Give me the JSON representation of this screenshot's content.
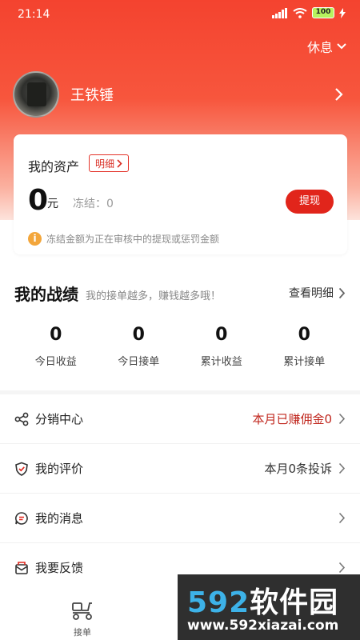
{
  "status_bar": {
    "time": "21:14",
    "battery": "100"
  },
  "header": {
    "rest_label": "休息",
    "user_name": "王铁锤"
  },
  "assets": {
    "title": "我的资产",
    "detail_label": "明细",
    "amount": "0",
    "unit": "元",
    "frozen_label": "冻结：0",
    "withdraw_label": "提现",
    "notice": "冻结金额为正在审核中的提现或惩罚金额"
  },
  "performance": {
    "title": "我的战绩",
    "subtitle": "我的接单越多，赚钱越多哦！",
    "view_detail": "查看明细",
    "stats": [
      {
        "value": "0",
        "label": "今日收益"
      },
      {
        "value": "0",
        "label": "今日接单"
      },
      {
        "value": "0",
        "label": "累计收益"
      },
      {
        "value": "0",
        "label": "累计接单"
      }
    ]
  },
  "menu": [
    {
      "label": "分销中心",
      "right": "本月已赚佣金0",
      "icon": "share-icon",
      "right_color": "#c0271e"
    },
    {
      "label": "我的评价",
      "right": "本月0条投诉",
      "icon": "review-icon",
      "right_color": "#333333"
    },
    {
      "label": "我的消息",
      "right": "",
      "icon": "message-icon"
    },
    {
      "label": "我要反馈",
      "right": "",
      "icon": "feedback-icon"
    }
  ],
  "tabbar": {
    "order_label": "接单"
  },
  "watermark": {
    "line1_num": "592",
    "line1_text": "软件园",
    "line2": "www.592xiazai.com"
  },
  "colors": {
    "accent": "#e1251b",
    "hero_top": "#f4432f"
  }
}
